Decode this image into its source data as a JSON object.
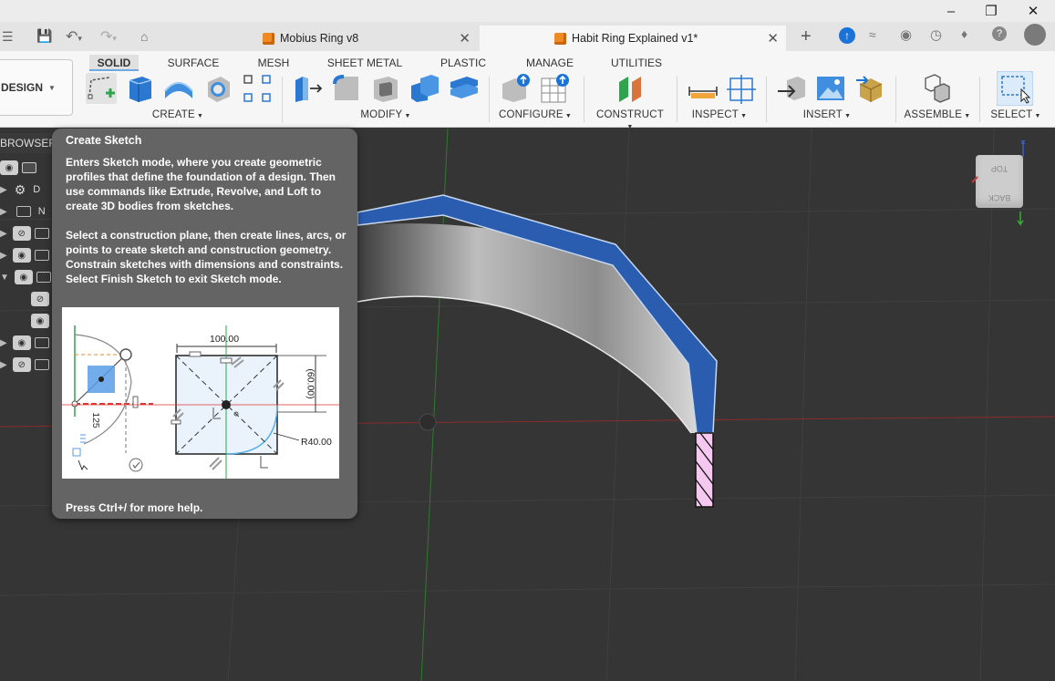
{
  "tabs": [
    {
      "name": "Mobius Ring v8",
      "active": false
    },
    {
      "name": "Habit Ring Explained v1*",
      "active": true
    }
  ],
  "workspace": {
    "label": "DESIGN"
  },
  "ribbon": {
    "tabs": [
      "SOLID",
      "SURFACE",
      "MESH",
      "SHEET METAL",
      "PLASTIC",
      "MANAGE",
      "UTILITIES"
    ],
    "groups": [
      "CREATE",
      "MODIFY",
      "CONFIGURE",
      "CONSTRUCT",
      "INSPECT",
      "INSERT",
      "ASSEMBLE",
      "SELECT"
    ]
  },
  "browser": {
    "label": "BROWSER",
    "row_letters": [
      "D",
      "N"
    ]
  },
  "tooltip": {
    "title": "Create Sketch",
    "para1": "Enters Sketch mode, where you create geometric profiles that define the foundation of a design. Then use commands like Extrude, Revolve, and Loft to create 3D bodies from sketches.",
    "para2": "Select a construction plane, then create lines, arcs, or points to create sketch and construction geometry. Constrain sketches with dimensions and constraints. Select Finish Sketch to exit Sketch mode.",
    "image": {
      "dim_width": "100.00",
      "dim_height": "(60.00)",
      "dim_radius": "R40.00",
      "dim_left": "125"
    },
    "footer": "Press Ctrl+/ for more help."
  },
  "viewcube": {
    "top": "TOP",
    "back": "BACK"
  },
  "colors": {
    "accent": "#6da9e3",
    "body_face": "#2a5db0",
    "profile": "#f5c8f0",
    "viewport": "#353535"
  }
}
